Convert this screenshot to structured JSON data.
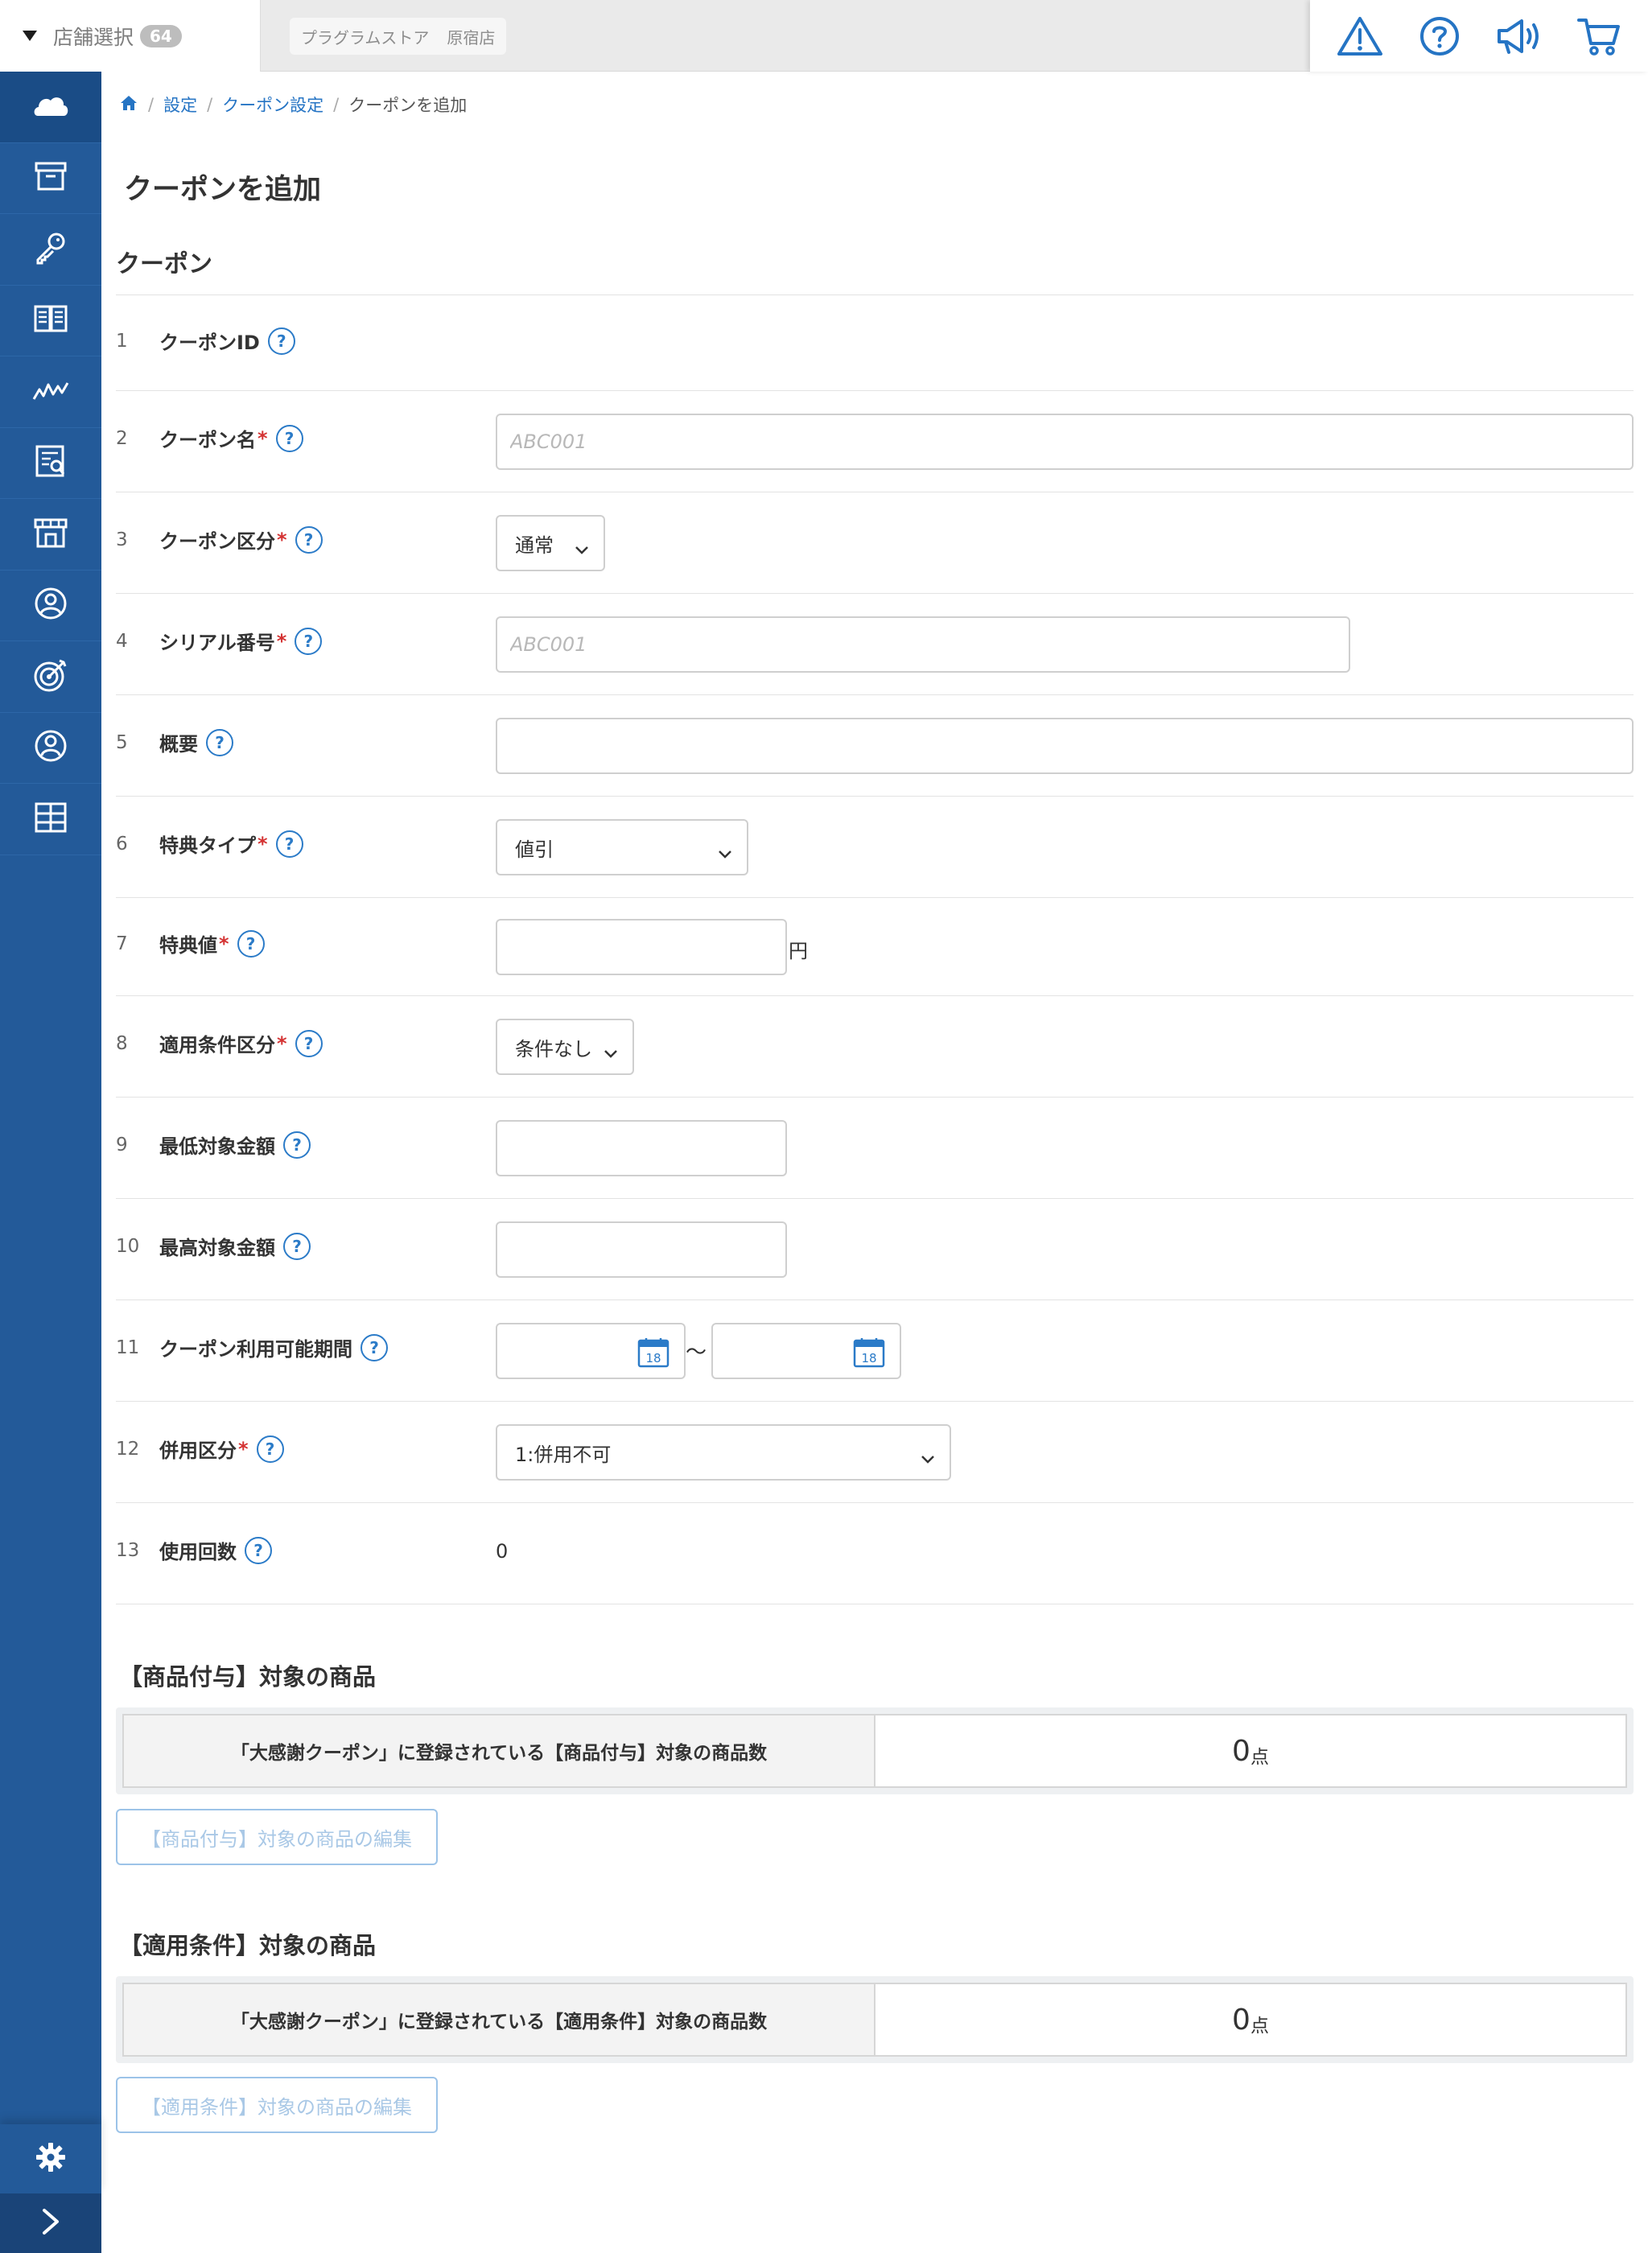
{
  "topbar": {
    "store_select_label": "店舗選択",
    "store_count": "64",
    "store_name_parts": [
      "プラグラムストア",
      "原宿店"
    ],
    "icons": [
      "warning-icon",
      "help-circle-icon",
      "announcement-icon",
      "cart-icon"
    ]
  },
  "sidebar": {
    "items": [
      "cloud-icon",
      "archive-box-icon",
      "key-icon",
      "book-icon",
      "chart-line-icon",
      "report-icon",
      "store-icon",
      "user-circle-icon",
      "target-icon",
      "member-icon",
      "grid-icon"
    ],
    "bottom": [
      "gear-icon",
      "chevron-right-icon"
    ]
  },
  "breadcrumb": {
    "home": "home-icon",
    "items": [
      "設定",
      "クーポン設定"
    ],
    "current": "クーポンを追加"
  },
  "page_title": "クーポンを追加",
  "section_title": "クーポン",
  "help_symbol": "?",
  "required_mark": "*",
  "form": {
    "rows": [
      {
        "num": "1",
        "label": "クーポンID"
      },
      {
        "num": "2",
        "label": "クーポン名",
        "placeholder": "ABC001"
      },
      {
        "num": "3",
        "label": "クーポン区分",
        "value": "通常"
      },
      {
        "num": "4",
        "label": "シリアル番号",
        "placeholder": "ABC001"
      },
      {
        "num": "5",
        "label": "概要",
        "value": ""
      },
      {
        "num": "6",
        "label": "特典タイプ",
        "value": "値引"
      },
      {
        "num": "7",
        "label": "特典値",
        "value": "",
        "unit": "円"
      },
      {
        "num": "8",
        "label": "適用条件区分",
        "value": "条件なし"
      },
      {
        "num": "9",
        "label": "最低対象金額",
        "value": ""
      },
      {
        "num": "10",
        "label": "最高対象金額",
        "value": ""
      },
      {
        "num": "11",
        "label": "クーポン利用可能期間",
        "separator": "〜",
        "calendar_day": "18"
      },
      {
        "num": "12",
        "label": "併用区分",
        "value": "1:併用不可"
      },
      {
        "num": "13",
        "label": "使用回数",
        "value": "0"
      }
    ]
  },
  "products_grant": {
    "title": "【商品付与】対象の商品",
    "table_header": "「大感謝クーポン」に登録されている【商品付与】対象の商品数",
    "count": "0",
    "count_unit": "点",
    "edit_button": "【商品付与】対象の商品の編集"
  },
  "products_condition": {
    "title": "【適用条件】対象の商品",
    "table_header": "「大感謝クーポン」に登録されている【適用条件】対象の商品数",
    "count": "0",
    "count_unit": "点",
    "edit_button": "【適用条件】対象の商品の編集"
  },
  "colors": {
    "sidebar": "#235a99",
    "accent": "#2b7bc8",
    "required": "#d43232"
  }
}
